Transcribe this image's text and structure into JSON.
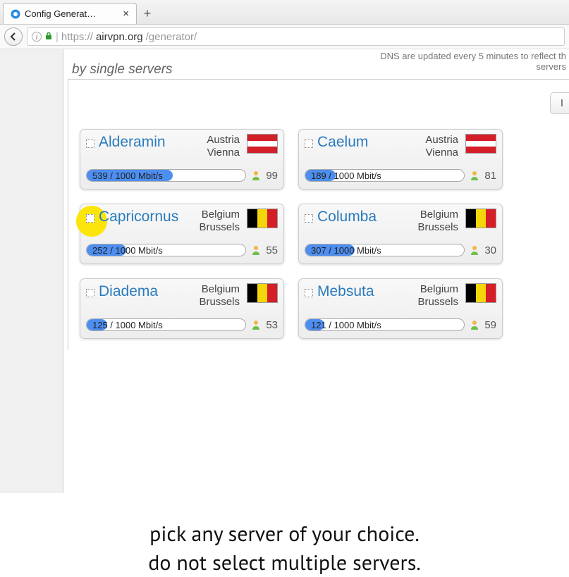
{
  "browser": {
    "tab_title": "Config Generat…",
    "url_prefix": "https://",
    "url_host": "airvpn.org",
    "url_path": "/generator/"
  },
  "page": {
    "note_top": "DNS are updated every 5 minutes to reflect th",
    "note_sub": "servers",
    "heading": "by single servers",
    "invert_label": "I"
  },
  "servers": [
    {
      "name": "Alderamin",
      "country": "Austria",
      "city": "Vienna",
      "flag": "at",
      "load_label": "539 / 1000 Mbit/s",
      "fill_pct": 54,
      "users": 99,
      "highlight": false
    },
    {
      "name": "Caelum",
      "country": "Austria",
      "city": "Vienna",
      "flag": "at",
      "load_label": "189 / 1000 Mbit/s",
      "fill_pct": 19,
      "users": 81,
      "highlight": false
    },
    {
      "name": "Capricornus",
      "country": "Belgium",
      "city": "Brussels",
      "flag": "be",
      "load_label": "252 / 1000 Mbit/s",
      "fill_pct": 25,
      "users": 55,
      "highlight": true
    },
    {
      "name": "Columba",
      "country": "Belgium",
      "city": "Brussels",
      "flag": "be",
      "load_label": "307 / 1000 Mbit/s",
      "fill_pct": 31,
      "users": 30,
      "highlight": false
    },
    {
      "name": "Diadema",
      "country": "Belgium",
      "city": "Brussels",
      "flag": "be",
      "load_label": "125 / 1000 Mbit/s",
      "fill_pct": 13,
      "users": 53,
      "highlight": false
    },
    {
      "name": "Mebsuta",
      "country": "Belgium",
      "city": "Brussels",
      "flag": "be",
      "load_label": "121 / 1000 Mbit/s",
      "fill_pct": 12,
      "users": 59,
      "highlight": false
    }
  ],
  "instructions": {
    "line1": "pick any server of your choice.",
    "line2": "do not select multiple servers."
  }
}
